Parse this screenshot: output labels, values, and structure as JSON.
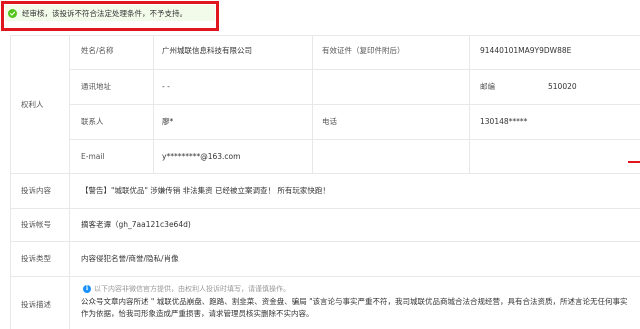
{
  "status": {
    "message": "经审核，该投诉不符合法定处理条件，不予支持。",
    "icon": "check-circle-icon",
    "color": "#52c41a",
    "highlight_border": "#e0161e"
  },
  "rights_holder": {
    "section_label": "权利人",
    "name_label": "姓名/名称",
    "name_value": "广州城联信息科技有限公司",
    "id_label": "有效证件（复印件附后）",
    "id_value": "91440101MA9Y9DW88E",
    "address_label": "通讯地址",
    "address_value": "- -",
    "postcode_label": "邮编",
    "postcode_value": "510020",
    "contact_label": "联系人",
    "contact_value": "廖*",
    "phone_label": "电话",
    "phone_value": "130148*****",
    "email_label": "E-mail",
    "email_value": "y*********@163.com"
  },
  "complaint": {
    "content_label": "投诉内容",
    "content_value": "【警告】\"城联优品\" 涉嫌传销 非法集资 已经被立案调查！ 所有玩家快跑！",
    "account_label": "投诉帐号",
    "account_value": "摘客老谭（gh_7aa121c3e64d)",
    "type_label": "投诉类型",
    "type_value": "内容侵犯名誉/商誉/隐私/肖像",
    "desc_label": "投诉描述",
    "note_icon": "info-icon",
    "note_text": "以下内容非微信官方提供，由权利人投诉时填写，请谨慎操作。",
    "desc_value": "公众号文章内容所述 \" 城联优品崩盘、跑路、割韭菜、资金盘、骗局 \"该言论与事实严重不符，我司城联优品商城合法合规经营，具有合法资质，所述言论无任何事实作为依据，恰我司形象造成严重损害，请求管理员核实删除不实内容。"
  }
}
